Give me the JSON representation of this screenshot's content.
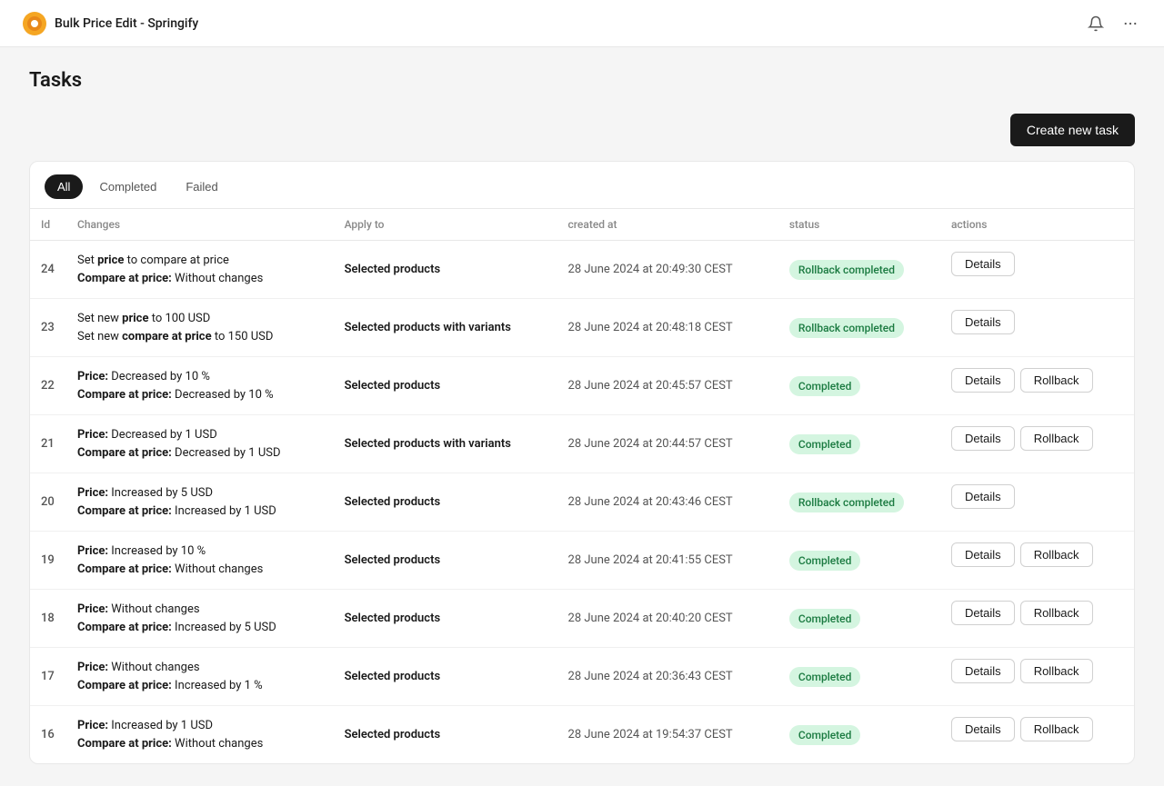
{
  "header": {
    "title": "Bulk Price Edit - Springify"
  },
  "page": {
    "title": "Tasks",
    "create_button": "Create new task"
  },
  "filters": {
    "tabs": [
      {
        "label": "All",
        "active": true
      },
      {
        "label": "Completed",
        "active": false
      },
      {
        "label": "Failed",
        "active": false
      }
    ]
  },
  "table": {
    "columns": [
      "Id",
      "Changes",
      "Apply to",
      "created at",
      "status",
      "actions"
    ],
    "rows": [
      {
        "id": "24",
        "changes_line1": "Set price to compare at price",
        "changes_line1_bold": "price",
        "changes_line2_label": "Compare at price:",
        "changes_line2_value": "Without changes",
        "apply_to": "Selected products",
        "created_at": "28 June 2024 at 20:49:30 CEST",
        "status": "Rollback completed",
        "status_type": "rollback-completed",
        "actions": [
          "Details"
        ]
      },
      {
        "id": "23",
        "changes_line1": "Set new price to 100 USD",
        "changes_line1_bold": "price",
        "changes_line2_label": "Set new compare at price",
        "changes_line2_value": "to 150 USD",
        "changes_line2_label_bold": "compare at price",
        "apply_to": "Selected products with variants",
        "created_at": "28 June 2024 at 20:48:18 CEST",
        "status": "Rollback completed",
        "status_type": "rollback-completed",
        "actions": [
          "Details"
        ]
      },
      {
        "id": "22",
        "changes_line1": "Price: Decreased by 10 %",
        "changes_line1_bold": "Price:",
        "changes_line2_label": "Compare at price:",
        "changes_line2_value": "Decreased by 10 %",
        "apply_to": "Selected products",
        "created_at": "28 June 2024 at 20:45:57 CEST",
        "status": "Completed",
        "status_type": "completed",
        "actions": [
          "Details",
          "Rollback"
        ]
      },
      {
        "id": "21",
        "changes_line1": "Price: Decreased by 1 USD",
        "changes_line1_bold": "Price:",
        "changes_line2_label": "Compare at price:",
        "changes_line2_value": "Decreased by 1 USD",
        "apply_to": "Selected products with variants",
        "created_at": "28 June 2024 at 20:44:57 CEST",
        "status": "Completed",
        "status_type": "completed",
        "actions": [
          "Details",
          "Rollback"
        ]
      },
      {
        "id": "20",
        "changes_line1": "Price: Increased by 5 USD",
        "changes_line1_bold": "Price:",
        "changes_line2_label": "Compare at price:",
        "changes_line2_value": "Increased by 1 USD",
        "apply_to": "Selected products",
        "created_at": "28 June 2024 at 20:43:46 CEST",
        "status": "Rollback completed",
        "status_type": "rollback-completed",
        "actions": [
          "Details"
        ]
      },
      {
        "id": "19",
        "changes_line1": "Price: Increased by 10 %",
        "changes_line1_bold": "Price:",
        "changes_line2_label": "Compare at price:",
        "changes_line2_value": "Without changes",
        "apply_to": "Selected products",
        "created_at": "28 June 2024 at 20:41:55 CEST",
        "status": "Completed",
        "status_type": "completed",
        "actions": [
          "Details",
          "Rollback"
        ]
      },
      {
        "id": "18",
        "changes_line1": "Price: Without changes",
        "changes_line1_bold": "Price:",
        "changes_line2_label": "Compare at price:",
        "changes_line2_value": "Increased by 5 USD",
        "apply_to": "Selected products",
        "created_at": "28 June 2024 at 20:40:20 CEST",
        "status": "Completed",
        "status_type": "completed",
        "actions": [
          "Details",
          "Rollback"
        ]
      },
      {
        "id": "17",
        "changes_line1": "Price: Without changes",
        "changes_line1_bold": "Price:",
        "changes_line2_label": "Compare at price:",
        "changes_line2_value": "Increased by 1 %",
        "apply_to": "Selected products",
        "created_at": "28 June 2024 at 20:36:43 CEST",
        "status": "Completed",
        "status_type": "completed",
        "actions": [
          "Details",
          "Rollback"
        ]
      },
      {
        "id": "16",
        "changes_line1": "Price: Increased by 1 USD",
        "changes_line1_bold": "Price:",
        "changes_line2_label": "Compare at price:",
        "changes_line2_value": "Without changes",
        "apply_to": "Selected products",
        "created_at": "28 June 2024 at 19:54:37 CEST",
        "status": "Completed",
        "status_type": "completed",
        "actions": [
          "Details",
          "Rollback"
        ]
      }
    ]
  }
}
